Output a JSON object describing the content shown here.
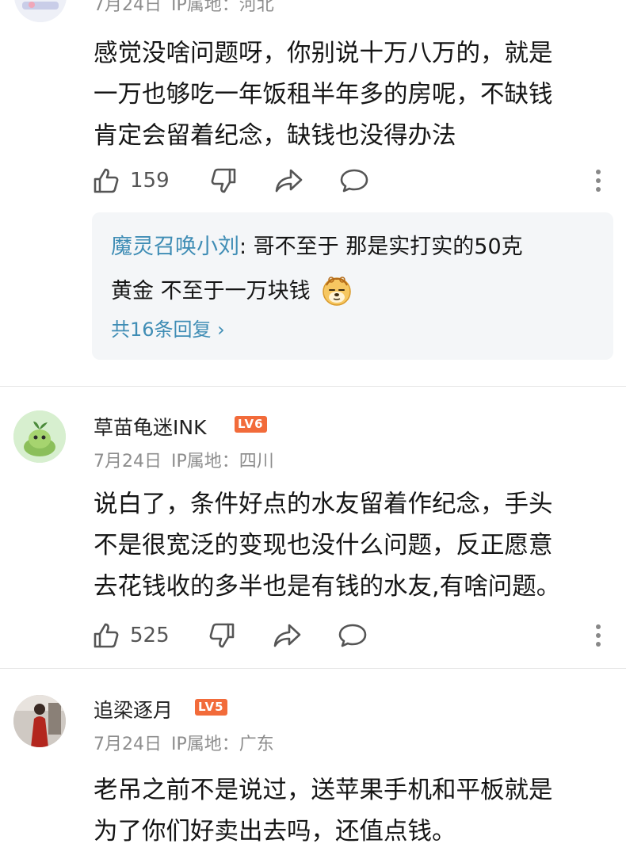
{
  "comment1": {
    "meta_date": "7月24日",
    "meta_ip": "IP属地：河北",
    "text_lines": [
      "感觉没啥问题呀，你别说十万八万的，就是",
      "一万也够吃一年饭租半年多的房呢，不缺钱",
      "肯定会留着纪念，缺钱也没得办法"
    ],
    "likes": "159",
    "reply": {
      "name": "魔灵召唤小刘",
      "line1_text": ": 哥不至于 那是实打实的50克",
      "line2_text": "黄金 不至于一万块钱",
      "emoji_icon": "doge-emoji-icon",
      "more_label": "共16条回复 ›"
    }
  },
  "comment2": {
    "username": "草苗龟迷INK",
    "level": "LV6",
    "meta_date": "7月24日",
    "meta_ip": "IP属地：四川",
    "text_lines": [
      "说白了，条件好点的水友留着作纪念，手头",
      "不是很宽泛的变现也没什么问题，反正愿意",
      "去花钱收的多半也是有钱的水友,有啥问题。"
    ],
    "likes": "525"
  },
  "comment3": {
    "username": "追梁逐月",
    "level": "LV5",
    "meta_date": "7月24日",
    "meta_ip": "IP属地：广东",
    "text_lines": [
      "老吊之前不是说过，送苹果手机和平板就是",
      "为了你们好卖出去吗，还值点钱。"
    ]
  },
  "colors": {
    "level_badge": "#f26b3a",
    "reply_name": "#3f8db5",
    "reply_bg": "#f4f6f8",
    "meta_gray": "#8d8d8d"
  },
  "icons": [
    "like-icon",
    "dislike-icon",
    "share-icon",
    "comment-icon",
    "more-icon"
  ]
}
